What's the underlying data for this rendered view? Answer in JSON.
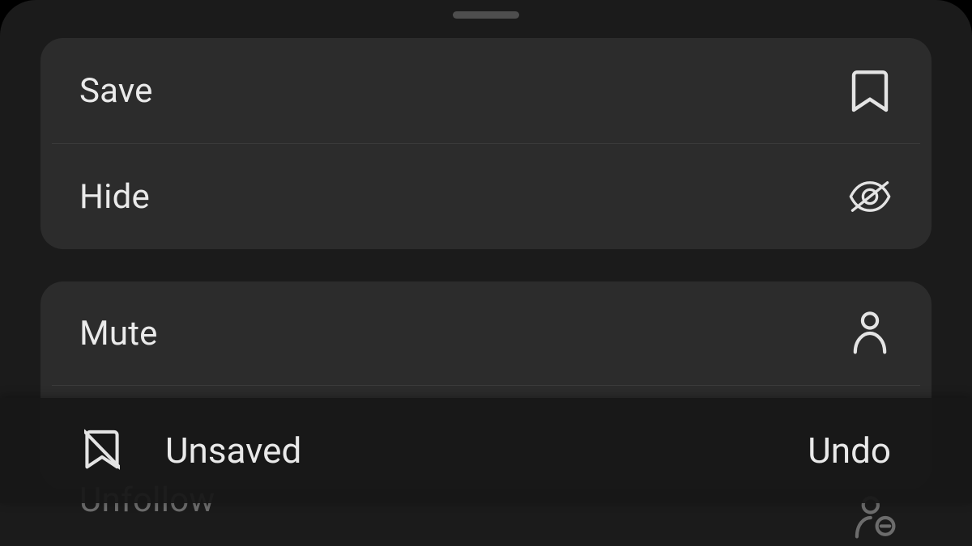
{
  "sheet": {
    "group1": {
      "save_label": "Save",
      "hide_label": "Hide"
    },
    "group2": {
      "mute_label": "Mute",
      "unfollow_label": "Unfollow"
    }
  },
  "toast": {
    "message": "Unsaved",
    "action_label": "Undo"
  },
  "colors": {
    "sheet_bg": "#1b1b1b",
    "card_bg": "#2c2c2c",
    "text": "#eaeaea",
    "muted_text": "#6c6c6c",
    "toast_bg": "rgba(23,23,23,0.92)",
    "divider": "#3a3a3a",
    "drag_handle": "#4e4e4e"
  }
}
